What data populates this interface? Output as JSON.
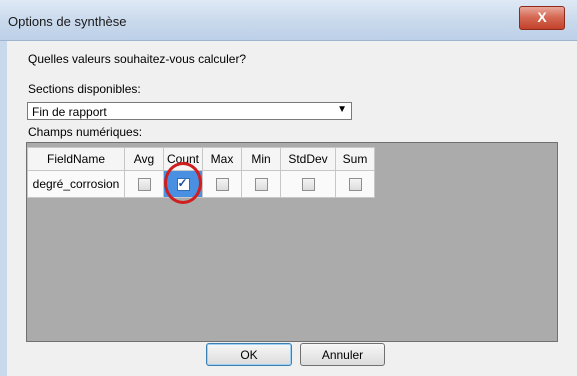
{
  "window": {
    "title": "Options de synthèse",
    "close_label": "X"
  },
  "dialog": {
    "question": "Quelles valeurs souhaitez-vous calculer?",
    "sections_label": "Sections disponibles:",
    "sections_value": "Fin de rapport",
    "champs_label": "Champs numériques:"
  },
  "grid": {
    "headers": [
      "FieldName",
      "Avg",
      "Count",
      "Max",
      "Min",
      "StdDev",
      "Sum"
    ],
    "rows": [
      {
        "field": "degré_corrosion",
        "avg": false,
        "count": true,
        "max": false,
        "min": false,
        "stddev": false,
        "sum": false
      }
    ]
  },
  "buttons": {
    "ok": "OK",
    "cancel": "Annuler"
  },
  "colors": {
    "annotation": "#d01d1d",
    "selection": "#4a90e2"
  }
}
